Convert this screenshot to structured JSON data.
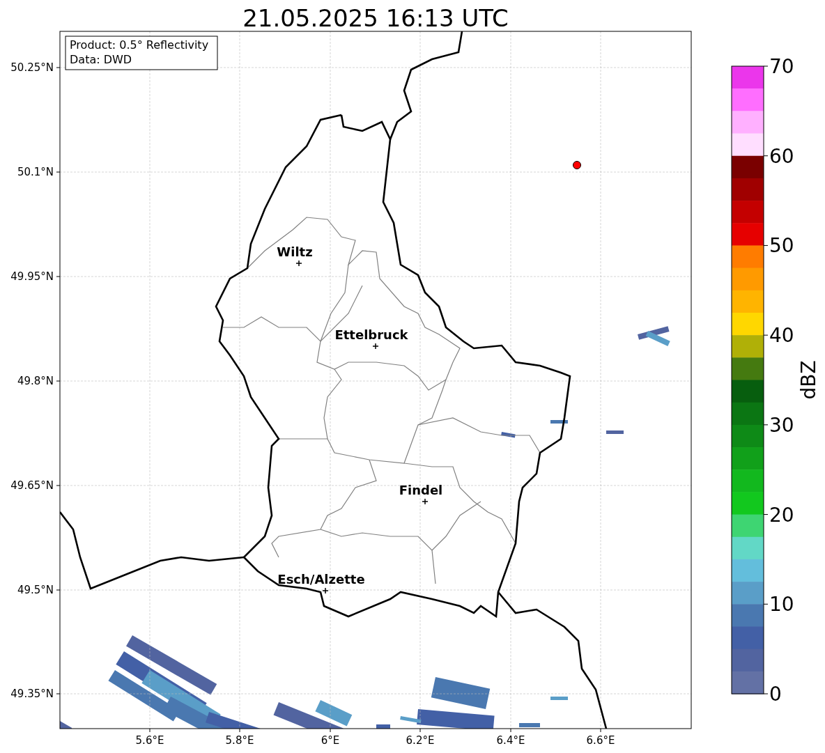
{
  "map": {
    "title": "21.05.2025 16:13 UTC",
    "cities": [
      "Wiltz",
      "Ettelbruck",
      "Findel",
      "Esch/Alzette"
    ],
    "xtick_labels": [
      "5.6°E",
      "5.8°E",
      "6°E",
      "6.2°E",
      "6.4°E",
      "6.6°E"
    ],
    "ytick_labels": [
      "50.25°N",
      "50.1°N",
      "49.95°N",
      "49.8°N",
      "49.65°N",
      "49.5°N",
      "49.35°N"
    ]
  },
  "info_box": [
    "Product: 0.5° Reflectivity",
    "Data: DWD"
  ],
  "colorbar": {
    "label": "dBZ",
    "ticks": [
      "70",
      "60",
      "50",
      "40",
      "30",
      "20",
      "10",
      "0"
    ],
    "bins": [
      {
        "color": "#eb36eb"
      },
      {
        "color": "#ff6eff"
      },
      {
        "color": "#ffb0ff"
      },
      {
        "color": "#ffdeff"
      },
      {
        "color": "#7a0000"
      },
      {
        "color": "#a00000"
      },
      {
        "color": "#c40000"
      },
      {
        "color": "#e60000"
      },
      {
        "color": "#ff7c00"
      },
      {
        "color": "#ff9a00"
      },
      {
        "color": "#ffb400"
      },
      {
        "color": "#ffd700"
      },
      {
        "color": "#b0b007"
      },
      {
        "color": "#457a10"
      },
      {
        "color": "#075e0e"
      },
      {
        "color": "#0b7613"
      },
      {
        "color": "#0e8a17"
      },
      {
        "color": "#11a01a"
      },
      {
        "color": "#12b81e"
      },
      {
        "color": "#12c81e"
      },
      {
        "color": "#3ed572"
      },
      {
        "color": "#62d8c6"
      },
      {
        "color": "#63bedc"
      },
      {
        "color": "#5a9ec8"
      },
      {
        "color": "#4a78b0"
      },
      {
        "color": "#4360a6"
      },
      {
        "color": "#5264a0"
      },
      {
        "color": "#6371a5"
      }
    ]
  }
}
